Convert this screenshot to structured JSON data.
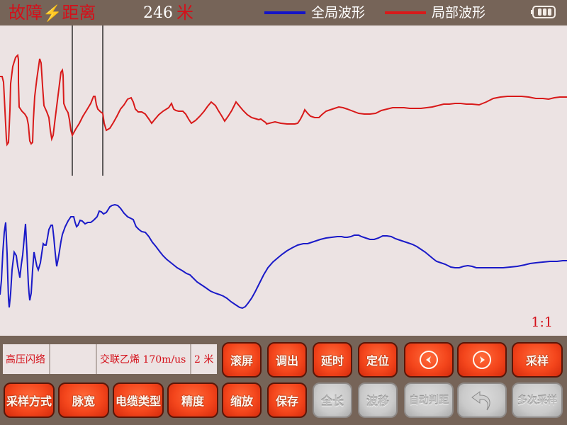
{
  "header": {
    "title_left": "故障",
    "title_icon": "lightning-icon",
    "title_right": "距离",
    "distance_value": "246",
    "distance_unit": "米",
    "legend": [
      {
        "label": "全局波形",
        "color": "#1414c8"
      },
      {
        "label": "局部波形",
        "color": "#d81a1a"
      }
    ],
    "battery_icon": "battery-icon",
    "battery_level_bars": 3
  },
  "plot": {
    "scale_ratio": "1:1",
    "colors": {
      "local": "#d81a1a",
      "global": "#1a1ac8",
      "cursor": "#000000"
    }
  },
  "info": {
    "mode": "高压闪络",
    "empty": "",
    "cable": "交联乙烯  170m/us",
    "precision": "2 米"
  },
  "buttons": {
    "row1": [
      {
        "label": "滚屏",
        "style": "red"
      },
      {
        "label": "调出",
        "style": "red"
      },
      {
        "label": "延时",
        "style": "red"
      },
      {
        "label": "定位",
        "style": "red"
      },
      {
        "label": "",
        "icon": "arrow-left-icon",
        "style": "red"
      },
      {
        "label": "",
        "icon": "arrow-right-icon",
        "style": "red"
      },
      {
        "label": "采样",
        "style": "red"
      }
    ],
    "row2": [
      {
        "label": "采样方式",
        "style": "red"
      },
      {
        "label": "脉宽",
        "style": "red"
      },
      {
        "label": "电缆类型",
        "style": "red"
      },
      {
        "label": "精度",
        "style": "red"
      },
      {
        "label": "缩放",
        "style": "red"
      },
      {
        "label": "保存",
        "style": "red"
      },
      {
        "label": "全长",
        "style": "gray"
      },
      {
        "label": "波移",
        "style": "gray"
      },
      {
        "label": "自动判距",
        "style": "gray"
      },
      {
        "label": "",
        "icon": "undo-icon",
        "style": "gray"
      },
      {
        "label": "多次采样",
        "style": "gray"
      }
    ]
  }
}
